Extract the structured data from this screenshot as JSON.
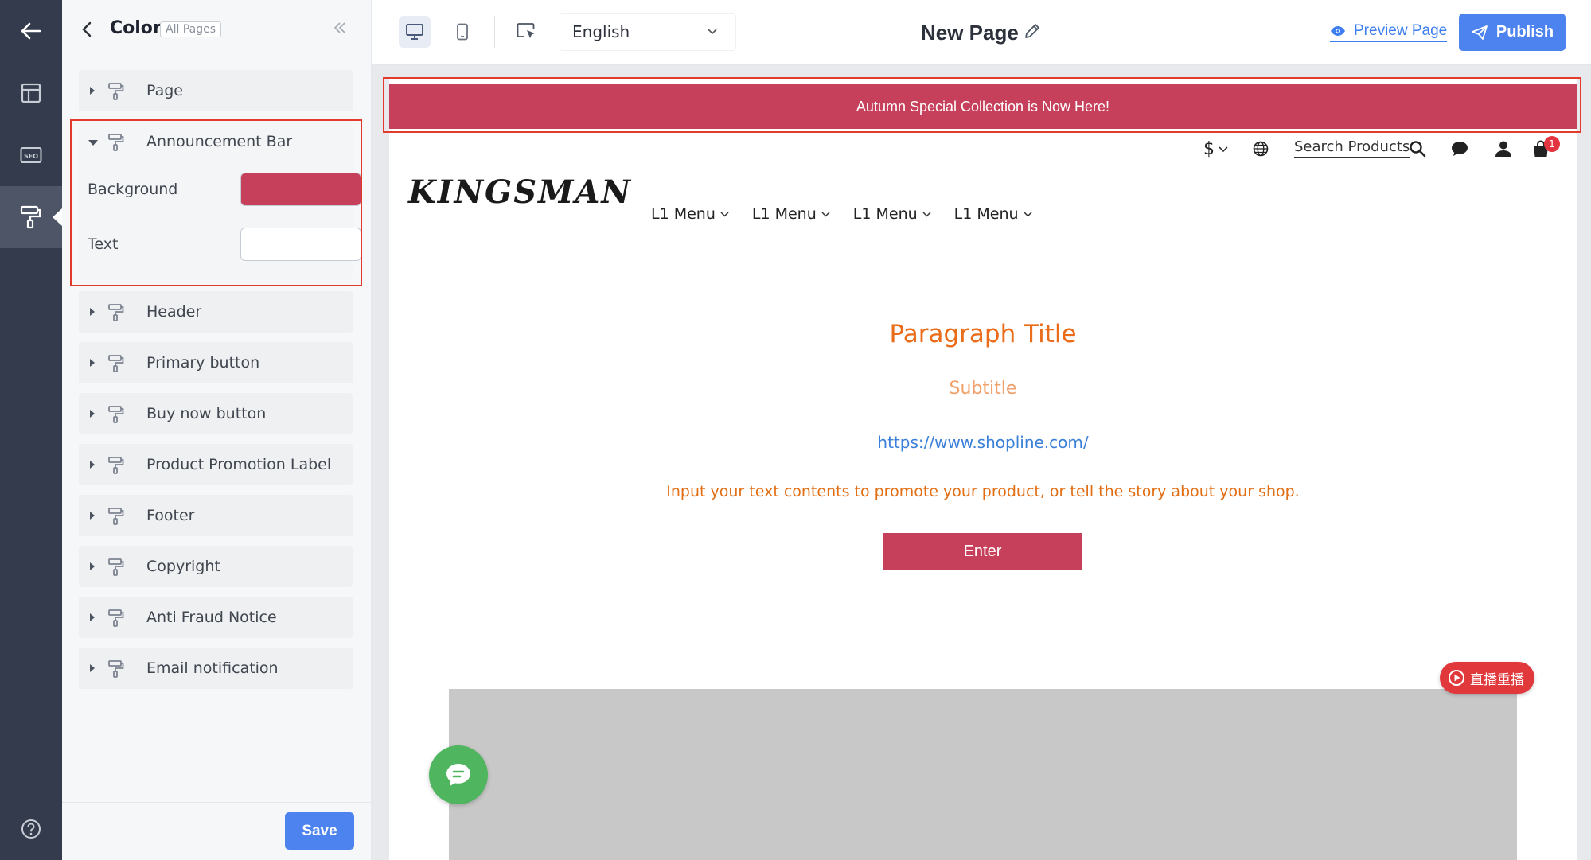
{
  "rail": {
    "items": [
      "back-arrow-icon",
      "layout-icon",
      "seo-icon",
      "paint-roller-icon",
      "help-icon"
    ]
  },
  "panel": {
    "title": "Color",
    "scope": "All Pages",
    "sections": [
      {
        "label": "Page"
      },
      {
        "label": "Announcement Bar",
        "open": true
      },
      {
        "label": "Header"
      },
      {
        "label": "Primary button"
      },
      {
        "label": "Buy now button"
      },
      {
        "label": "Product Promotion Label"
      },
      {
        "label": "Footer"
      },
      {
        "label": "Copyright"
      },
      {
        "label": "Anti Fraud Notice"
      },
      {
        "label": "Email notification"
      }
    ],
    "announcement": {
      "background_label": "Background",
      "background_color": "#c6405b",
      "text_label": "Text",
      "text_color": "#ffffff"
    },
    "save_label": "Save"
  },
  "toolbar": {
    "language": "English",
    "page_name": "New Page",
    "preview_label": "Preview Page",
    "publish_label": "Publish"
  },
  "site": {
    "announcement_text": "Autumn Special Collection is Now Here!",
    "currency_symbol": "$",
    "search_label": "Search Products",
    "cart_count": "1",
    "logo": "KINGSMAN",
    "nav": [
      "L1 Menu",
      "L1 Menu",
      "L1 Menu",
      "L1 Menu"
    ],
    "paragraph_title": "Paragraph Title",
    "subtitle": "Subtitle",
    "link": "https://www.shopline.com/",
    "body_text": "Input your text contents to promote your product, or tell the story about your shop.",
    "enter_label": "Enter",
    "replay_label": "直播重播"
  },
  "colors": {
    "accent_blue": "#4d83ef",
    "brand_red": "#c6405b",
    "title_orange": "#ea6b18",
    "highlight_red": "#e23b2e",
    "chat_green": "#4fb55f"
  }
}
